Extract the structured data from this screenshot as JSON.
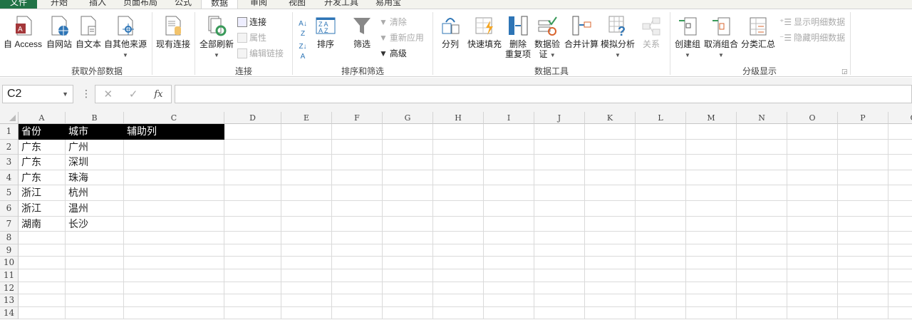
{
  "tabs": [
    "文件",
    "开始",
    "插入",
    "页面布局",
    "公式",
    "数据",
    "审阅",
    "视图",
    "开发工具",
    "易用宝"
  ],
  "active_tab": "数据",
  "ribbon": {
    "get_external": {
      "label": "获取外部数据",
      "buttons": [
        "自 Access",
        "自网站",
        "自文本",
        "自其他来源",
        "现有连接"
      ]
    },
    "connections": {
      "label": "连接",
      "refresh_all": "全部刷新",
      "connections": "连接",
      "properties": "属性",
      "edit_links": "编辑链接"
    },
    "sort_filter": {
      "label": "排序和筛选",
      "sort": "排序",
      "filter": "筛选",
      "clear": "清除",
      "reapply": "重新应用",
      "advanced": "高级"
    },
    "data_tools": {
      "label": "数据工具",
      "text_to_columns": "分列",
      "flash_fill": "快速填充",
      "remove_dup_1": "删除",
      "remove_dup_2": "重复项",
      "validation_1": "数据验",
      "validation_2": "证",
      "consolidate": "合并计算",
      "what_if": "模拟分析",
      "relationships": "关系"
    },
    "outline": {
      "label": "分级显示",
      "group": "创建组",
      "ungroup": "取消组合",
      "subtotal": "分类汇总",
      "show_detail": "显示明细数据",
      "hide_detail": "隐藏明细数据"
    }
  },
  "formula_bar": {
    "name_box": "C2",
    "cancel": "✕",
    "enter": "✓",
    "fx": "fx",
    "formula": ""
  },
  "sheet": {
    "columns": [
      "A",
      "B",
      "C",
      "D",
      "E",
      "F",
      "G",
      "H",
      "I",
      "J",
      "K",
      "L",
      "M",
      "N",
      "O",
      "P",
      "Q"
    ],
    "row_numbers": [
      "1",
      "2",
      "3",
      "4",
      "5",
      "6",
      "7",
      "8",
      "9",
      "10",
      "11",
      "12",
      "13",
      "14"
    ],
    "rows": [
      [
        "省份",
        "城市",
        "辅助列"
      ],
      [
        "广东",
        "广州",
        ""
      ],
      [
        "广东",
        "深圳",
        ""
      ],
      [
        "广东",
        "珠海",
        ""
      ],
      [
        "浙江",
        "杭州",
        ""
      ],
      [
        "浙江",
        "温州",
        ""
      ],
      [
        "湖南",
        "长沙",
        ""
      ]
    ],
    "selected_cell": "C2"
  }
}
